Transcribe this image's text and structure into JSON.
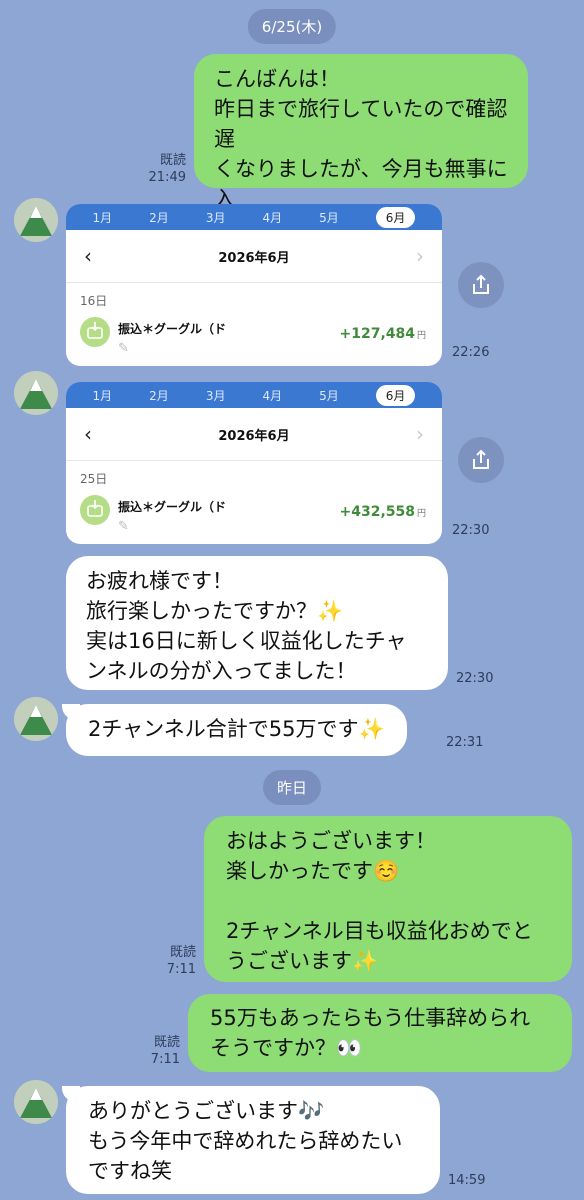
{
  "date_pills": [
    "6/25(木)",
    "昨日"
  ],
  "read_label": "既読",
  "messages": {
    "m1": {
      "text": "こんばんは！\n昨日まで旅行していたので確認遅\nくなりましたが、今月も無事に入\nってましたか？👀",
      "time": "21:49"
    },
    "m2": {
      "time": "22:26"
    },
    "m3": {
      "time": "22:30"
    },
    "m4": {
      "text": "お疲れ様です！\n旅行楽しかったですか？✨\n実は16日に新しく収益化したチャ\nンネルの分が入ってました！",
      "time": "22:30"
    },
    "m5": {
      "text": "2チャンネル合計で55万です✨",
      "time": "22:31"
    },
    "m6": {
      "text": "おはようございます！\n楽しかったです☺️\n\n2チャンネル目も収益化おめでと\nうございます✨",
      "time": "7:11"
    },
    "m7": {
      "text": "55万もあったらもう仕事辞められ\nそうですか？👀",
      "time": "7:11"
    },
    "m8": {
      "text": "ありがとうございます🎶\nもう今年中で辞めれたら辞めたい\nですね笑",
      "time": "14:59"
    }
  },
  "cards": [
    {
      "months": [
        "1月",
        "2月",
        "3月",
        "4月",
        "5月",
        "6月"
      ],
      "active_month": "6月",
      "header": "2026年6月",
      "day": "16日",
      "desc": "振込＊グーグル（ド",
      "amount": "+127,484",
      "yen": "円"
    },
    {
      "months": [
        "1月",
        "2月",
        "3月",
        "4月",
        "5月",
        "6月"
      ],
      "active_month": "6月",
      "header": "2026年6月",
      "day": "25日",
      "desc": "振込＊グーグル（ド",
      "amount": "+432,558",
      "yen": "円"
    }
  ],
  "colors": {
    "background": "#8ea6d3",
    "outgoing_bubble": "#8ddc74",
    "incoming_bubble": "#ffffff",
    "card_tab_bar": "#3a78d2",
    "amount_green": "#3f8b3a"
  },
  "icons": [
    "mountain-avatar",
    "share-icon",
    "chevron-left-icon",
    "chevron-right-icon",
    "bank-transfer-icon",
    "pencil-icon"
  ]
}
